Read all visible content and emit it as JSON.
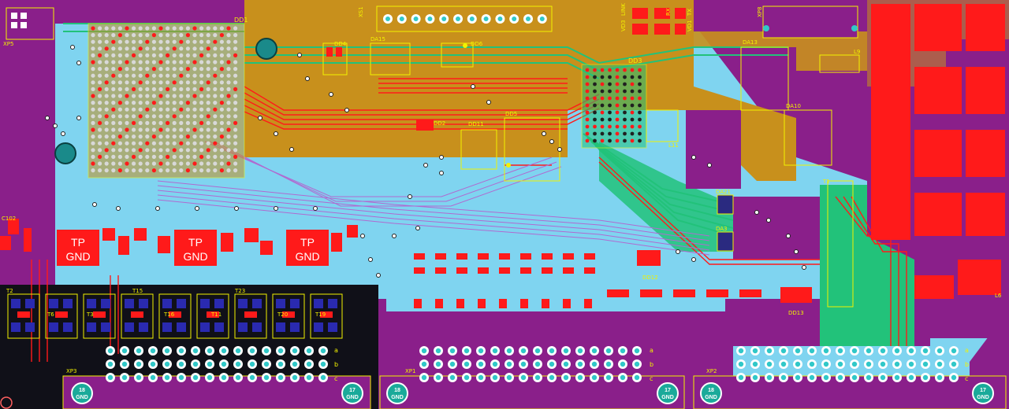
{
  "colors": {
    "board": "#8a1f8a",
    "plane_gold": "#c8901c",
    "plane_cyan": "#7fd4f0",
    "plane_green": "#22c27a",
    "copper_red": "#ff1a1a",
    "via_cyan": "#30c8c8",
    "silkscreen": "#f2f200",
    "dark_region": "#101018"
  },
  "connectors": {
    "top_header": "XS1",
    "xp5": "XP5",
    "xp8": "XP8",
    "xp3": "XP3",
    "xp1": "XP1",
    "xp2": "XP2"
  },
  "components": {
    "dd1": "DD1",
    "dd3": "DD3",
    "dd4": "DD4",
    "dd6": "DD6",
    "dd2": "DD2",
    "dd11": "DD11",
    "dd5": "DD5",
    "dd12": "DD12",
    "dd13": "DD13",
    "da15": "DA15",
    "da13": "DA13",
    "da10": "DA10",
    "da21": "DA21",
    "da3": "DA3",
    "t1": "T1",
    "l11": "L11",
    "l9": "L9",
    "l6": "L6",
    "t2": "T2",
    "t3": "T3",
    "t6": "T6",
    "t11": "T11",
    "t15": "T15",
    "t16": "T16",
    "t19": "T19",
    "t20": "T20",
    "t23": "T23",
    "c102": "C102",
    "vd3": "VD3",
    "vd1": "VD1",
    "led_link": "LINK",
    "led_tx": "TX",
    "led_rx": "RX"
  },
  "test_points": [
    {
      "line1": "TP",
      "line2": "GND"
    },
    {
      "line1": "TP",
      "line2": "GND"
    },
    {
      "line1": "TP",
      "line2": "GND"
    }
  ],
  "mount_pins": [
    {
      "line1": "18",
      "line2": "GND"
    },
    {
      "line1": "17",
      "line2": "GND"
    },
    {
      "line1": "18",
      "line2": "GND"
    },
    {
      "line1": "17",
      "line2": "GND"
    },
    {
      "line1": "18",
      "line2": "GND"
    },
    {
      "line1": "17",
      "line2": "GND"
    }
  ],
  "row_markers": [
    "a",
    "b",
    "c"
  ]
}
